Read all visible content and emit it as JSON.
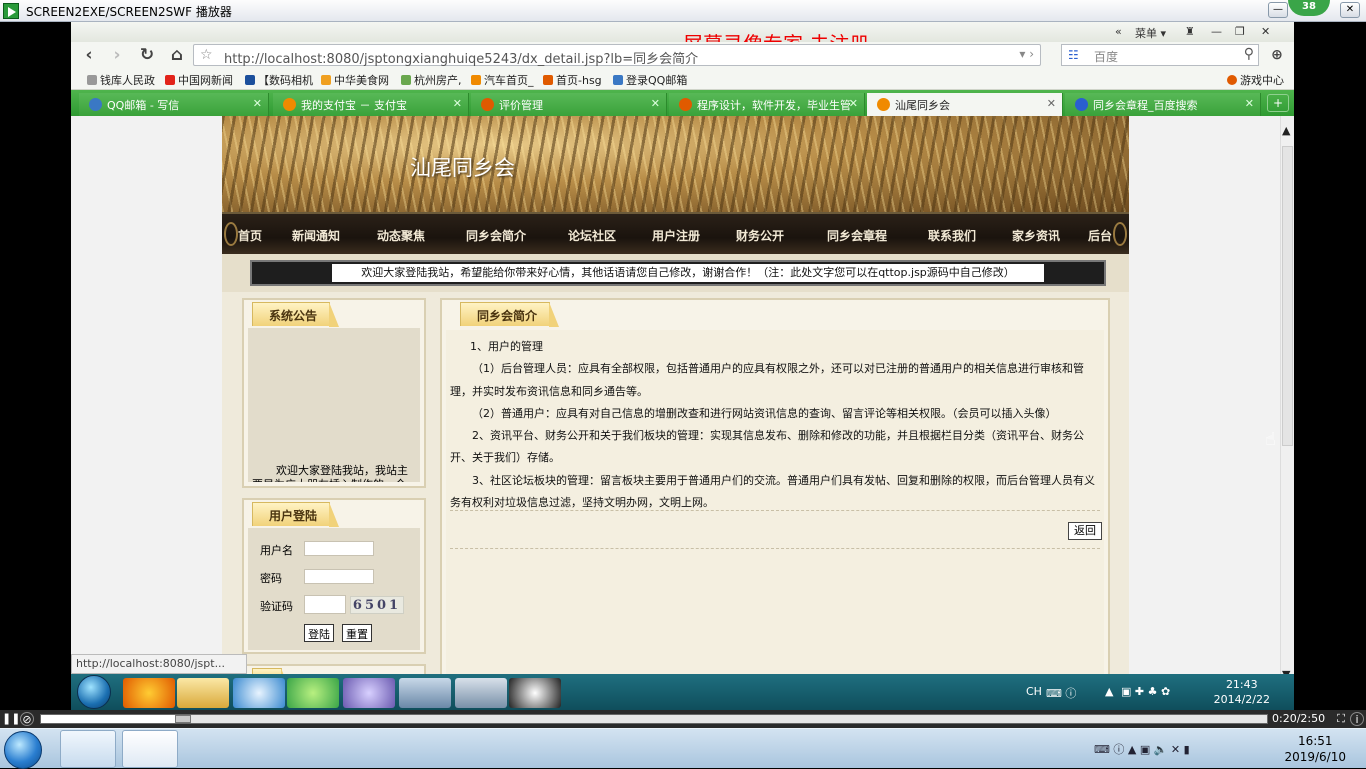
{
  "player": {
    "title": "SCREEN2EXE/SCREEN2SWF 播放器",
    "badge": "38",
    "timecode": "0:20/2:50",
    "progress": 0.116
  },
  "browser": {
    "watermark": "屏幕录像专家  未注册",
    "menu_label": "菜单 ▾",
    "url": "http://localhost:8080/jsptongxianghuiqe5243/dx_detail.jsp?lb=同乡会简介",
    "search_placeholder": "百度",
    "bookmarks": [
      {
        "label": "钱库人民政",
        "color": "#999999"
      },
      {
        "label": "中国网新闻",
        "color": "#e2231a"
      },
      {
        "label": "【数码相机",
        "color": "#1b4f9c"
      },
      {
        "label": "中华美食网",
        "color": "#f0a020"
      },
      {
        "label": "杭州房产,",
        "color": "#6aa84f"
      },
      {
        "label": "汽车首页_",
        "color": "#f08a00"
      },
      {
        "label": "首页-hsg",
        "color": "#e05a00"
      },
      {
        "label": "登录QQ邮箱",
        "color": "#3a78c4"
      }
    ],
    "game_center": "游戏中心",
    "tabs": [
      {
        "label": "QQ邮箱 - 写信",
        "color": "#3a78c4",
        "active": false
      },
      {
        "label": "我的支付宝 － 支付宝",
        "color": "#f08a00",
        "active": false
      },
      {
        "label": "评价管理",
        "color": "#e05a00",
        "active": false
      },
      {
        "label": "程序设计，软件开发，毕业生管",
        "color": "#e05a00",
        "active": false
      },
      {
        "label": "汕尾同乡会",
        "color": "#f08a00",
        "active": true
      },
      {
        "label": "同乡会章程_百度搜索",
        "color": "#2a5fd0",
        "active": false
      }
    ],
    "status_url": "http://localhost:8080/jspt..."
  },
  "site": {
    "title": "汕尾同乡会",
    "nav": [
      "首页",
      "新闻通知",
      "动态聚焦",
      "同乡会简介",
      "论坛社区",
      "用户注册",
      "财务公开",
      "同乡会章程",
      "联系我们",
      "家乡资讯",
      "后台"
    ],
    "marquee": "欢迎大家登陆我站，希望能给你带来好心情，其他话语请您自己修改，谢谢合作！（注：此处文字您可以在qttop.jsp源码中自己修改）",
    "notice": {
      "title": "系统公告",
      "text": "欢迎大家登陆我站，我站主要是为广大朋友插入制作的，今后"
    },
    "login": {
      "title": "用户登陆",
      "username_label": "用户名",
      "password_label": "密码",
      "captcha_label": "验证码",
      "captcha_code": "6501",
      "login_button": "登陆",
      "reset_button": "重置"
    },
    "content": {
      "title": "同乡会简介",
      "paragraphs": [
        "1、用户的管理",
        "（1）后台管理人员：应具有全部权限，包括普通用户的应具有权限之外，还可以对已注册的普通用户的相关信息进行审核和管理，并实时发布资讯信息和同乡通告等。",
        "（2）普通用户：应具有对自己信息的增删改查和进行网站资讯信息的查询、留言评论等相关权限。（会员可以插入头像）",
        "2、资讯平台、财务公开和关于我们板块的管理：实现其信息发布、删除和修改的功能，并且根据栏目分类（资讯平台、财务公开、关于我们）存储。",
        "3、社区论坛板块的管理：留言板块主要用于普通用户们的交流。普通用户们具有发帖、回复和删除的权限，而后台管理人员有义务有权利对垃圾信息过滤，坚持文明办网，文明上网。"
      ],
      "back_button": "返回"
    }
  },
  "inner_taskbar": {
    "time": "21:43",
    "date": "2014/2/22",
    "lang": "CH"
  },
  "outer_taskbar": {
    "time": "16:51",
    "date": "2019/6/10"
  }
}
